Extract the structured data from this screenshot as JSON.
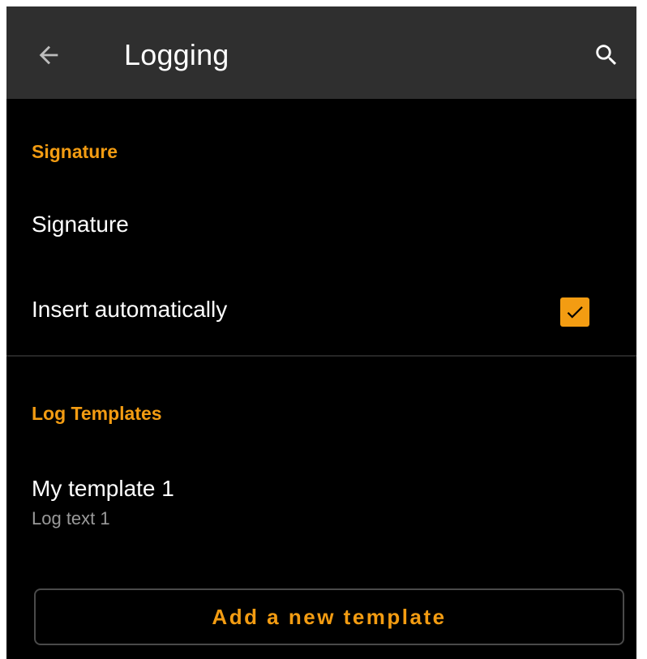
{
  "appbar": {
    "title": "Logging",
    "back_icon": "arrow-left-icon",
    "search_icon": "search-icon"
  },
  "sections": {
    "signature": {
      "header": "Signature",
      "signature_pref": {
        "title": "Signature"
      },
      "insert_automatically": {
        "title": "Insert automatically",
        "checked": true
      }
    },
    "log_templates": {
      "header": "Log Templates",
      "templates": [
        {
          "title": "My template 1",
          "summary": "Log text 1"
        }
      ],
      "add_button_label": "Add a new template"
    }
  },
  "colors": {
    "accent": "#f39c12",
    "appbar": "#2f2f2f",
    "background": "#000000",
    "text_primary": "#ffffff",
    "text_secondary": "#9a9a9a"
  }
}
